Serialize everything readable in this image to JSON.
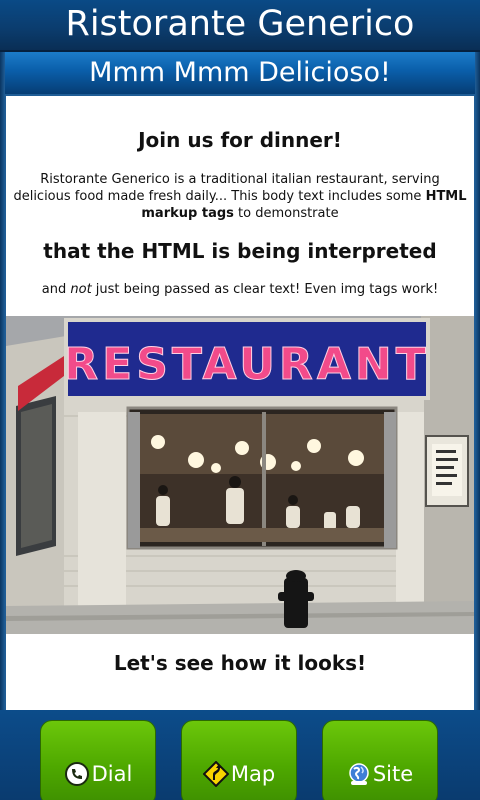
{
  "header": {
    "title": "Ristorante Generico",
    "subtitle": "Mmm Mmm Delicioso!"
  },
  "content": {
    "heading_join": "Join us for dinner!",
    "body_part1": "Ristorante Generico is a traditional italian restaurant, serving delicious food made fresh daily... This body text includes some ",
    "body_bold": "HTML markup tags",
    "body_part2": " to demonstrate",
    "heading_html": "that the HTML is being interpreted",
    "line_prefix": "and ",
    "line_em": "not",
    "line_suffix": " just being passed as clear text! Even img tags work!",
    "photo_sign": "RESTAURANT",
    "heading_see": "Let's see how it looks!"
  },
  "buttons": {
    "dial": {
      "label": "Dial",
      "icon": "phone-icon"
    },
    "map": {
      "label": "Map",
      "icon": "road-sign-icon"
    },
    "site": {
      "label": "Site",
      "icon": "globe-icon"
    }
  },
  "colors": {
    "header_dark": "#0b3d6f",
    "subtitle_blue": "#0a5ea9",
    "button_green": "#4ea800",
    "sign_red": "#d8253c"
  }
}
